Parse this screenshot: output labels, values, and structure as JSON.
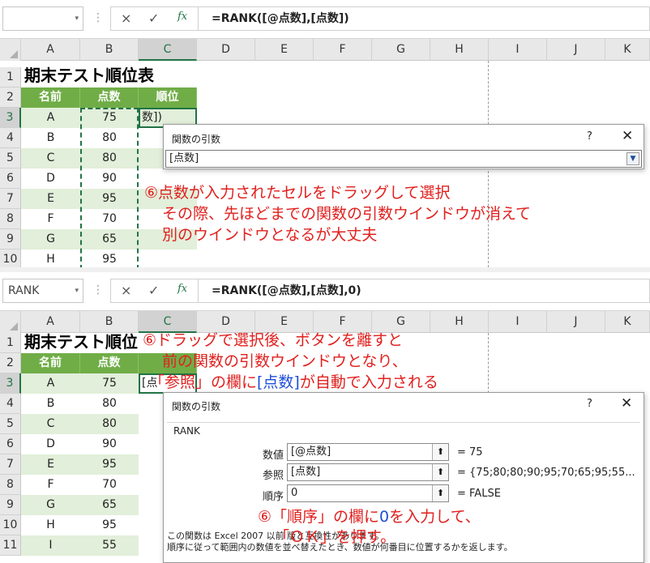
{
  "top": {
    "namebox": "",
    "formula": "=RANK([@点数],[点数])",
    "columns": [
      "A",
      "B",
      "C",
      "D",
      "E",
      "F",
      "G",
      "H",
      "I",
      "J",
      "K"
    ],
    "rows": [
      "1",
      "2",
      "3",
      "4",
      "5",
      "6",
      "7",
      "8",
      "9",
      "10"
    ],
    "title": "期末テスト順位表",
    "headers": {
      "name": "名前",
      "score": "点数",
      "rank": "順位"
    },
    "data": [
      {
        "name": "A",
        "score": "75"
      },
      {
        "name": "B",
        "score": "80"
      },
      {
        "name": "C",
        "score": "80"
      },
      {
        "name": "D",
        "score": "90"
      },
      {
        "name": "E",
        "score": "95"
      },
      {
        "name": "F",
        "score": "70"
      },
      {
        "name": "G",
        "score": "65"
      },
      {
        "name": "H",
        "score": "95"
      }
    ],
    "c3_text": "数])",
    "dialog": {
      "title": "関数の引数",
      "help": "?",
      "close": "✕",
      "value": "[点数]"
    },
    "note": [
      "⑥点数が入力されたセルをドラッグして選択",
      "その際、先ほどまでの関数の引数ウインドウが消えて",
      "別のウインドウとなるが大丈夫"
    ]
  },
  "bottom": {
    "namebox": "RANK",
    "formula": "=RANK([@点数],[点数],0)",
    "columns": [
      "A",
      "B",
      "C",
      "D",
      "E",
      "F",
      "G",
      "H",
      "I",
      "J",
      "K"
    ],
    "rows": [
      "1",
      "2",
      "3",
      "4",
      "5",
      "6",
      "7",
      "8",
      "9",
      "10",
      "11"
    ],
    "title": "期末テスト順位",
    "headers": {
      "name": "名前",
      "score": "点数"
    },
    "data": [
      {
        "name": "A",
        "score": "75"
      },
      {
        "name": "B",
        "score": "80"
      },
      {
        "name": "C",
        "score": "80"
      },
      {
        "name": "D",
        "score": "90"
      },
      {
        "name": "E",
        "score": "95"
      },
      {
        "name": "F",
        "score": "70"
      },
      {
        "name": "G",
        "score": "65"
      },
      {
        "name": "H",
        "score": "95"
      },
      {
        "name": "I",
        "score": "55"
      }
    ],
    "c3_text": "[点",
    "dialog": {
      "title": "関数の引数",
      "help": "?",
      "close": "✕",
      "func": "RANK",
      "args": [
        {
          "label": "数値",
          "value": "[@点数]",
          "result": "= 75"
        },
        {
          "label": "参照",
          "value": "[点数]",
          "result": "= {75;80;80;90;95;70;65;95;55..."
        },
        {
          "label": "順序",
          "value": "0",
          "result": "= FALSE"
        }
      ],
      "desc1": "この関数は Excel 2007 以前",
      "desc1b": "版と互換性があります。",
      "desc2": "順序に従って範囲内の数値を並べ替えたとき、数値が何番目に位置するかを返します。"
    },
    "note1": {
      "l1": "⑥ドラッグで選択後、ボタンを離すと",
      "l2": "前の関数の引数ウインドウとなり、",
      "l3a": "「参照」の欄に",
      "l3b": "[点数]",
      "l3c": "が自動で入力される"
    },
    "note2": {
      "l1a": "⑥「順序」の欄に",
      "l1b": "0",
      "l1c": "を入力して、",
      "l2": "「ＯＫ」を押す。"
    }
  },
  "icons": {
    "cancel": "×",
    "enter": "✓",
    "fx": "fx",
    "dropdown": "▾",
    "collapse": "⬆"
  },
  "colors": {
    "header_green": "#70ad47",
    "row_band": "#e2efda",
    "selection": "#217346",
    "note_red": "#e0201e",
    "note_blue": "#1d4ed8"
  }
}
